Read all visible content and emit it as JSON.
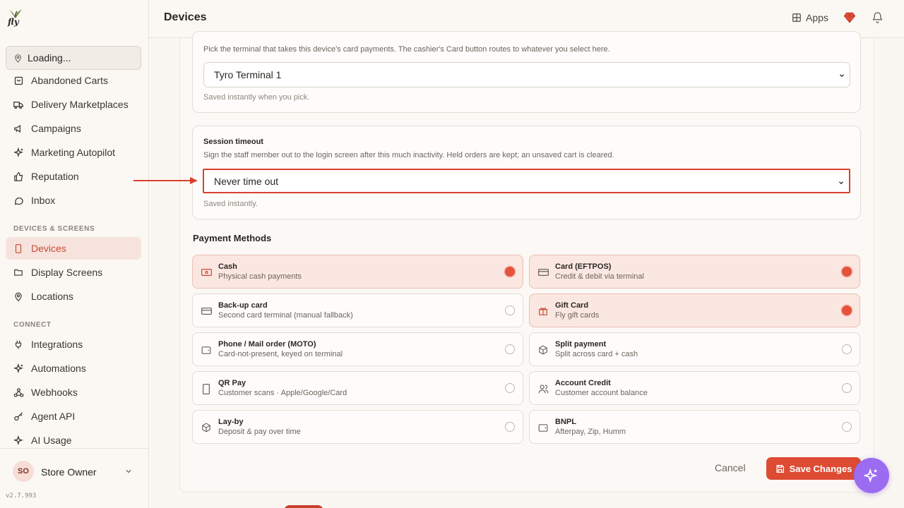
{
  "brand": {
    "logo_text": "fly"
  },
  "sidebar": {
    "location": "Loading...",
    "items_top": [
      {
        "label": "Abandoned Carts"
      },
      {
        "label": "Delivery Marketplaces"
      },
      {
        "label": "Campaigns"
      },
      {
        "label": "Marketing Autopilot"
      },
      {
        "label": "Reputation"
      },
      {
        "label": "Inbox"
      }
    ],
    "section_devices": "DEVICES & SCREENS",
    "items_devices": [
      {
        "label": "Devices"
      },
      {
        "label": "Display Screens"
      },
      {
        "label": "Locations"
      }
    ],
    "section_connect": "CONNECT",
    "items_connect": [
      {
        "label": "Integrations"
      },
      {
        "label": "Automations"
      },
      {
        "label": "Webhooks"
      },
      {
        "label": "Agent API"
      },
      {
        "label": "AI Usage"
      }
    ],
    "user": {
      "initials": "SO",
      "name": "Store Owner"
    },
    "version": "v2.7.993"
  },
  "topbar": {
    "title": "Devices",
    "apps_label": "Apps"
  },
  "terminal": {
    "desc": "Pick the terminal that takes this device's card payments. The cashier's Card button routes to whatever you select here.",
    "value": "Tyro Terminal 1",
    "hint": "Saved instantly when you pick."
  },
  "session": {
    "title": "Session timeout",
    "desc": "Sign the staff member out to the login screen after this much inactivity. Held orders are kept; an unsaved cart is cleared.",
    "value": "Never time out",
    "hint": "Saved instantly."
  },
  "payment_methods": {
    "title": "Payment Methods",
    "items": [
      {
        "name": "Cash",
        "desc": "Physical cash payments",
        "icon": "cash-icon",
        "selected": true
      },
      {
        "name": "Card (EFTPOS)",
        "desc": "Credit & debit via terminal",
        "icon": "card-icon",
        "selected": true
      },
      {
        "name": "Back-up card",
        "desc": "Second card terminal (manual fallback)",
        "icon": "card-icon",
        "selected": false
      },
      {
        "name": "Gift Card",
        "desc": "Fly gift cards",
        "icon": "gift-icon",
        "selected": true
      },
      {
        "name": "Phone / Mail order (MOTO)",
        "desc": "Card-not-present, keyed on terminal",
        "icon": "wallet-icon",
        "selected": false
      },
      {
        "name": "Split payment",
        "desc": "Split across card + cash",
        "icon": "box-icon",
        "selected": false
      },
      {
        "name": "QR Pay",
        "desc": "Customer scans · Apple/Google/Card",
        "icon": "phone-icon",
        "selected": false
      },
      {
        "name": "Account Credit",
        "desc": "Customer account balance",
        "icon": "users-icon",
        "selected": false
      },
      {
        "name": "Lay-by",
        "desc": "Deposit & pay over time",
        "icon": "box-icon",
        "selected": false
      },
      {
        "name": "BNPL",
        "desc": "Afterpay, Zip, Humm",
        "icon": "wallet-icon",
        "selected": false
      }
    ]
  },
  "actions": {
    "cancel": "Cancel",
    "save": "Save Changes"
  },
  "colors": {
    "accent": "#de4b33",
    "active_bg": "#f7e3dd",
    "fab": "#9b6cf0"
  }
}
